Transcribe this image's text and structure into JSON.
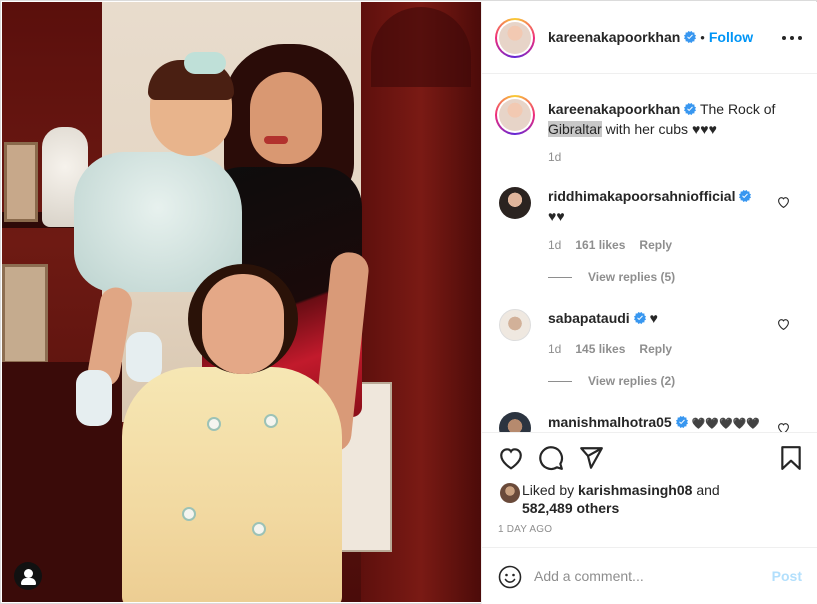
{
  "post": {
    "author": "kareenakapoorkhan",
    "follow_label": "Follow",
    "separator": "•",
    "caption": {
      "author": "kareenakapoorkhan",
      "text_before": "The Rock of",
      "highlight": "Gibraltar",
      "text_after": "with her cubs ♥♥♥",
      "time": "1d"
    },
    "comments": [
      {
        "user": "riddhimakapoorsahniofficial",
        "text": "♥♥",
        "time": "1d",
        "likes": "161 likes",
        "reply_label": "Reply",
        "view_replies": "View replies (5)"
      },
      {
        "user": "sabapataudi",
        "text": "♥",
        "time": "1d",
        "likes": "145 likes",
        "reply_label": "Reply",
        "view_replies": "View replies (2)"
      },
      {
        "user": "manishmalhotra05",
        "text": "🖤🖤🖤🖤🖤"
      }
    ],
    "liked_by": {
      "prefix": "Liked by",
      "user": "karishmasingh08",
      "and": "and",
      "others": "582,489 others"
    },
    "date": "1 DAY AGO",
    "add_comment": {
      "placeholder": "Add a comment...",
      "post_label": "Post"
    }
  },
  "icons": {
    "verified": "verified-badge-icon",
    "more": "more-options-icon",
    "like": "heart-icon",
    "comment": "comment-icon",
    "share": "share-icon",
    "save": "bookmark-icon",
    "emoji": "emoji-icon",
    "user_tag": "user-tag-icon"
  },
  "colors": {
    "link_blue": "#0095f6",
    "post_disabled": "#b2dffc",
    "muted": "#8e8e8e",
    "text": "#262626"
  }
}
